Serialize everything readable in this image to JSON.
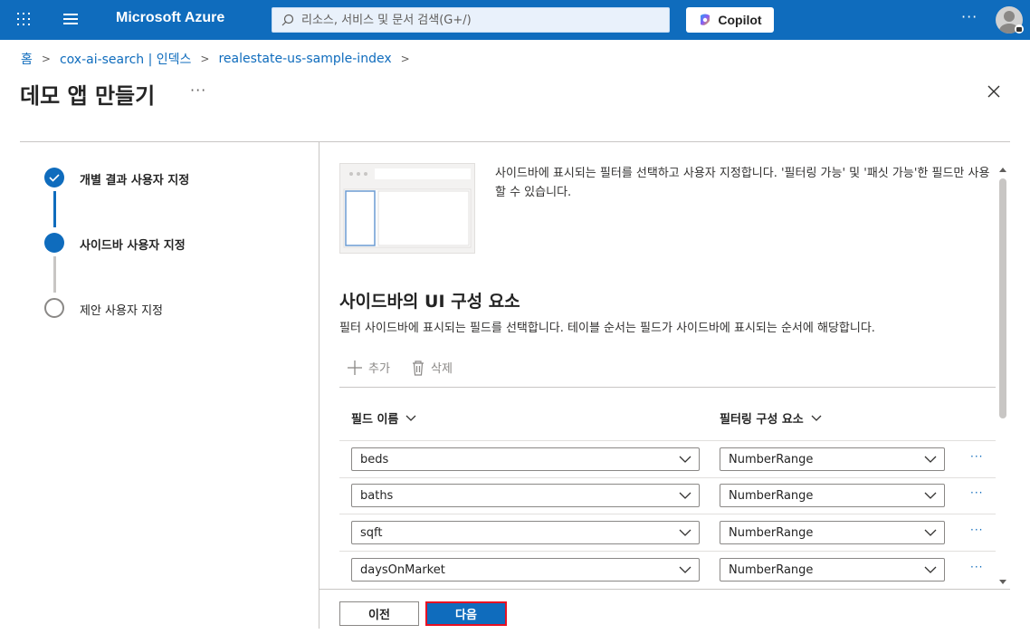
{
  "topbar": {
    "brand": "Microsoft Azure",
    "search_placeholder": "리소스, 서비스 및 문서 검색(G+/)",
    "copilot_label": "Copilot",
    "more": "···",
    "colors": {
      "bar": "#0f6cbd"
    }
  },
  "breadcrumb": {
    "items": [
      "홈",
      "cox-ai-search | 인덱스",
      "realestate-us-sample-index"
    ]
  },
  "page": {
    "title": "데모 앱 만들기",
    "title_more": "···"
  },
  "steps": [
    {
      "label": "개별 결과 사용자 지정",
      "state": "completed"
    },
    {
      "label": "사이드바 사용자 지정",
      "state": "current"
    },
    {
      "label": "제안 사용자 지정",
      "state": "pending"
    }
  ],
  "panel": {
    "description": "사이드바에 표시되는 필터를 선택하고 사용자 지정합니다. '필터링 가능' 및 '패싯 가능'한 필드만 사용할 수 있습니다.",
    "section_title": "사이드바의 UI 구성 요소",
    "section_sub": "필터 사이드바에 표시되는 필드를 선택합니다. 테이블 순서는 필드가 사이드바에 표시되는 순서에 해당합니다.",
    "add_label": "추가",
    "delete_label": "삭제",
    "columns": [
      "필드 이름",
      "필터링 구성 요소"
    ],
    "rows": [
      {
        "field": "beds",
        "component": "NumberRange"
      },
      {
        "field": "baths",
        "component": "NumberRange"
      },
      {
        "field": "sqft",
        "component": "NumberRange"
      },
      {
        "field": "daysOnMarket",
        "component": "NumberRange"
      }
    ],
    "row_more": "···"
  },
  "footer": {
    "prev_label": "이전",
    "next_label": "다음"
  }
}
